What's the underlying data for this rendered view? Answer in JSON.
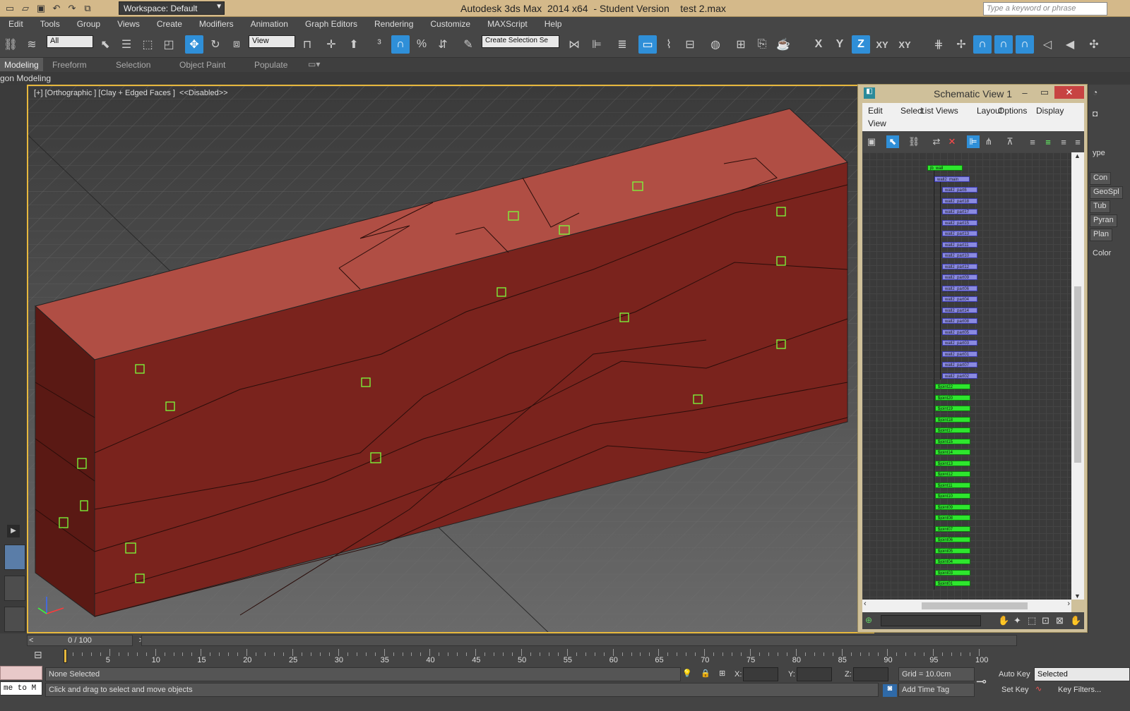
{
  "app": {
    "title": "Autodesk 3ds Max  2014 x64  - Student Version    test 2.max",
    "workspace": "Workspace: Default",
    "search_placeholder": "Type a keyword or phrase"
  },
  "menu": [
    "Edit",
    "Tools",
    "Group",
    "Views",
    "Create",
    "Modifiers",
    "Animation",
    "Graph Editors",
    "Rendering",
    "Customize",
    "MAXScript",
    "Help"
  ],
  "toolbar": {
    "selection_filter": "All",
    "ref_coord": "View",
    "named_selection": "Create Selection Se",
    "axes": [
      "X",
      "Y",
      "Z",
      "XY",
      "XY"
    ]
  },
  "ribbon": {
    "tabs": [
      "Modeling",
      "Freeform",
      "Selection",
      "Object Paint",
      "Populate"
    ],
    "sub": "gon Modeling"
  },
  "viewport": {
    "label": "[+] [Orthographic ] [Clay + Edged Faces ]  <<Disabled>>"
  },
  "schematic": {
    "title": "Schematic View 1",
    "menu": [
      "Edit",
      "Select",
      "List Views",
      "Layout",
      "Options",
      "Display",
      "View"
    ],
    "root": "jb_wall",
    "main": "wall2_main",
    "parts": [
      "wall2_part6",
      "wall2_part18",
      "wall2_part17",
      "wall2_part15",
      "wall2_part13",
      "wall2_part11",
      "wall2_part10",
      "wall2_part12",
      "wall2_part09",
      "wall2_part06",
      "wall2_part04",
      "wall2_part14",
      "wall2_part08",
      "wall2_part05",
      "wall2_part03",
      "wall2_part01",
      "wall2_part07",
      "wall2_part02"
    ],
    "joints": [
      "$joint22",
      "$joint20",
      "$joint19",
      "$joint18",
      "$joint17",
      "$joint15",
      "$joint14",
      "$joint13",
      "$joint12",
      "$joint11",
      "$joint10",
      "$joint09",
      "$joint08",
      "$joint07",
      "$joint06",
      "$joint05",
      "$joint04",
      "$joint03",
      "$joint01"
    ]
  },
  "command_panel": [
    "ype",
    "Con",
    "GeoSpl",
    "Tub",
    "Pyran",
    "Plan",
    "Color"
  ],
  "timeline": {
    "slider": "0 / 100",
    "start": 0,
    "end": 100,
    "labels": [
      "5",
      "10",
      "15",
      "20",
      "25",
      "30",
      "35",
      "40",
      "45",
      "50",
      "55",
      "60",
      "65",
      "70",
      "75",
      "80",
      "85",
      "90",
      "95",
      "100"
    ]
  },
  "status": {
    "selection": "None Selected",
    "prompt": "Click and drag to select and move objects",
    "maxscript": "me to M",
    "x_label": "X:",
    "y_label": "Y:",
    "z_label": "Z:",
    "grid": "Grid = 10.0cm",
    "add_time_tag": "Add Time Tag",
    "auto_key": "Auto Key",
    "set_key": "Set Key",
    "key_mode": "Selected",
    "key_filters": "Key Filters..."
  },
  "colors": {
    "viewport_border": "#e7b83d",
    "wall_front": "#7a231d",
    "wall_top": "#b04e44",
    "helper": "#7cff3a",
    "node_green": "#2ee62e",
    "node_blue": "#8a8ae0",
    "active_tool": "#2f8fd8"
  }
}
